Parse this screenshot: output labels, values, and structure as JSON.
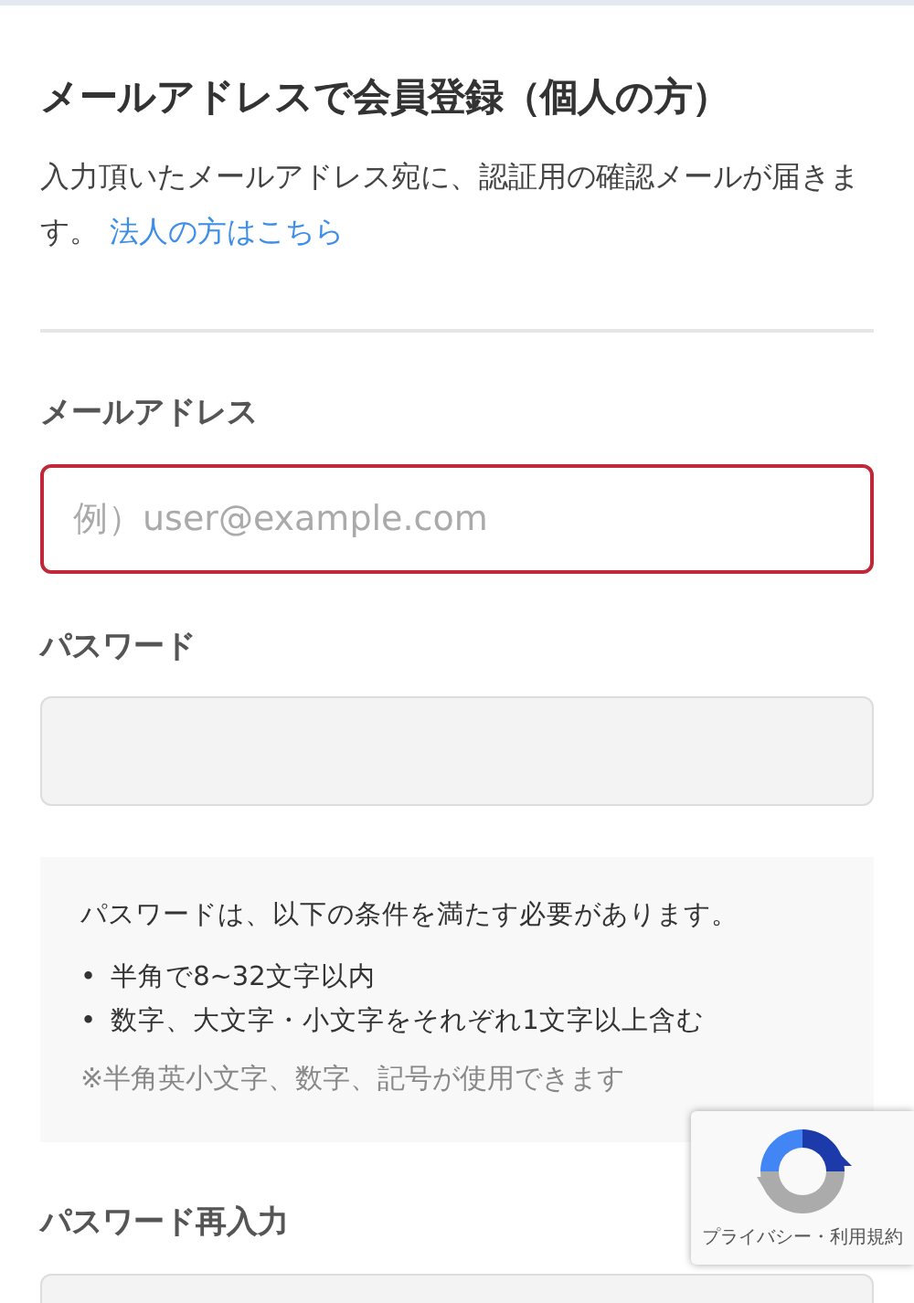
{
  "title": "メールアドレスで会員登録（個人の方）",
  "description": {
    "text": "入力頂いたメールアドレス宛に、認証用の確認メールが届きます。",
    "link": "法人の方はこちら"
  },
  "fields": [
    {
      "label": "メールアドレス",
      "placeholder": "例）user@example.com",
      "invalid": true,
      "kind": "email"
    },
    {
      "label": "パスワード",
      "invalid": false,
      "kind": "password"
    },
    {
      "kind": "note",
      "intro": "パスワードは、以下の条件を満たす必要があります。",
      "rules": [
        {
          "bullet": "•",
          "text": "半角で8~32文字以内"
        },
        {
          "bullet": "•",
          "text": "数字、大文字・小文字をそれぞれ1文字以上含む"
        }
      ],
      "footnote": "※半角英小文字、数字、記号が使用できます"
    },
    {
      "label": "パスワード再入力",
      "invalid": false,
      "kind": "password"
    }
  ],
  "recaptcha": {
    "text": "プライバシー・利用規約"
  }
}
